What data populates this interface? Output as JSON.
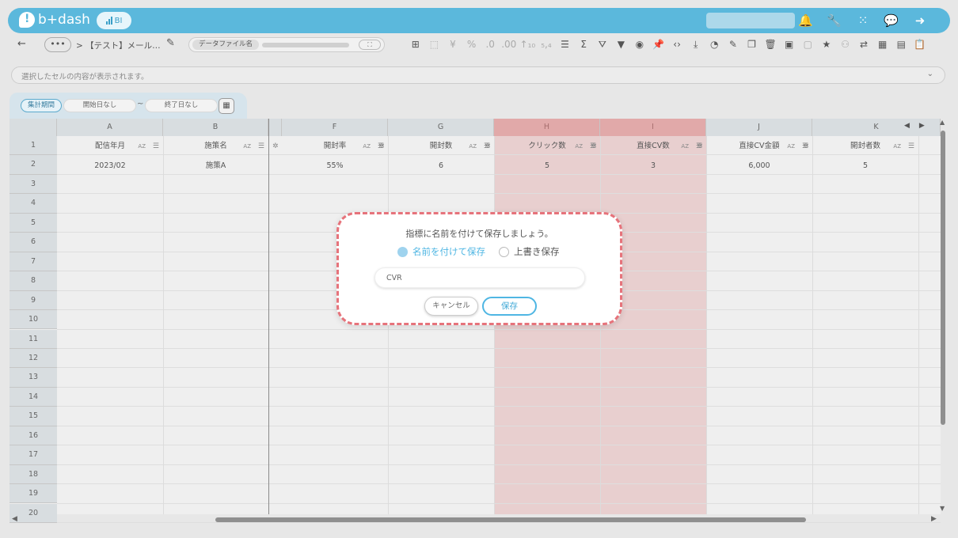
{
  "header": {
    "logo_text": "b+dash",
    "badge_text": "BI",
    "icons": [
      "bell-icon",
      "wrench-icon",
      "apps-grid-icon",
      "chat-icon",
      "logout-icon"
    ]
  },
  "toolbar": {
    "back": "←",
    "more": "•••",
    "breadcrumb": "> 【テスト】メール…",
    "datafile_label": "データファイル名",
    "expand": "⛶"
  },
  "formula_bar": {
    "placeholder": "選択したセルの内容が表示されます。"
  },
  "period": {
    "label": "集計期間",
    "start": "開始日なし",
    "separator": "~",
    "end": "終了日なし"
  },
  "grid": {
    "columns": [
      {
        "letter": "A",
        "header": "配信年月",
        "value": "2023/02"
      },
      {
        "letter": "B",
        "header": "施策名",
        "value": "施策A"
      },
      {
        "letter": "F",
        "header": "開封率",
        "value": "55%"
      },
      {
        "letter": "G",
        "header": "開封数",
        "value": "6"
      },
      {
        "letter": "H",
        "header": "クリック数",
        "value": "5"
      },
      {
        "letter": "I",
        "header": "直接CV数",
        "value": "3"
      },
      {
        "letter": "J",
        "header": "直接CV金額",
        "value": "6,000"
      },
      {
        "letter": "K",
        "header": "開封者数",
        "value": "5"
      }
    ],
    "rows": [
      "1",
      "2",
      "3",
      "4",
      "5",
      "6",
      "7",
      "8",
      "9",
      "10",
      "11",
      "12",
      "13",
      "14",
      "15",
      "16",
      "17",
      "18",
      "19",
      "20"
    ]
  },
  "modal": {
    "title": "指標に名前を付けて保存しましょう。",
    "option_save_as": "名前を付けて保存",
    "option_overwrite": "上書き保存",
    "selected_option": "名前を付けて保存",
    "name_value": "CVR",
    "cancel": "キャンセル",
    "save": "保存"
  }
}
